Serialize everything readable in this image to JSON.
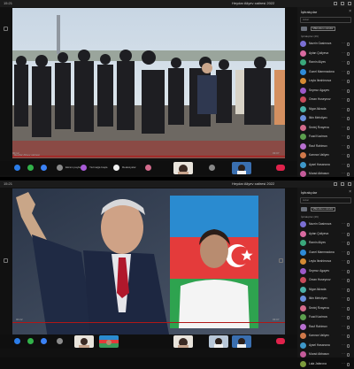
{
  "window": {
    "time": "15:21",
    "title": "Heydar Aliyev xatiresi 2022"
  },
  "top_panel": {
    "video_caption": "Heydar Aliyev xatiresi",
    "elapsed": "00:12",
    "duration": "03:07"
  },
  "bottom_panel": {
    "elapsed": "00:22",
    "duration": "03:07"
  },
  "toolbar": {
    "items": [
      {
        "name": "raise-hand",
        "color": "#2b7de9",
        "label": ""
      },
      {
        "name": "chat",
        "color": "#32b24a",
        "label": ""
      },
      {
        "name": "participants",
        "color": "#3b82f6",
        "label": ""
      },
      {
        "name": "share",
        "color": "#8b8b8b",
        "label": "Ekranı paylaş"
      },
      {
        "name": "record",
        "color": "#a85bd6",
        "label": "Yazmağa başla"
      },
      {
        "name": "reactions",
        "color": "#f0f0f0",
        "label": "Reaksiyalar"
      },
      {
        "name": "leave",
        "color": "#e0224b",
        "label": "Ayrıl"
      }
    ]
  },
  "sidebar": {
    "title": "İştirakçılar",
    "search_placeholder": "Axtar",
    "device_button": "Mikrofonu söndür",
    "section": "İştirakçılar (29)",
    "participants": [
      {
        "name": "Nazrin Gasimova",
        "color": "#7b6fd4"
      },
      {
        "name": "Aytan Quliyeva",
        "color": "#d96aa0"
      },
      {
        "name": "Ramin Aliyev",
        "color": "#3aa87b"
      },
      {
        "name": "Gunel Mammadova",
        "color": "#2e8bd8"
      },
      {
        "name": "Leyla Ibrahimova",
        "color": "#d58a33"
      },
      {
        "name": "Seymur Agayev",
        "color": "#9c59c9"
      },
      {
        "name": "Orxan Huseynov",
        "color": "#c94a5a"
      },
      {
        "name": "Nigar Alizada",
        "color": "#4bb0a8"
      },
      {
        "name": "Ilkin Mehdiyev",
        "color": "#6a8fdc"
      },
      {
        "name": "Sevinj Rzayeva",
        "color": "#d36b8c"
      },
      {
        "name": "Fuad Kazimov",
        "color": "#5c9e4e"
      },
      {
        "name": "Rauf Rahimov",
        "color": "#b86fd0"
      },
      {
        "name": "Kamran Valiyev",
        "color": "#d0794a"
      },
      {
        "name": "Aysel Hasanova",
        "color": "#3e98c9"
      },
      {
        "name": "Murad Abbasov",
        "color": "#c45b9a"
      },
      {
        "name": "Lala Jafarova",
        "color": "#7c9a3c"
      }
    ]
  }
}
